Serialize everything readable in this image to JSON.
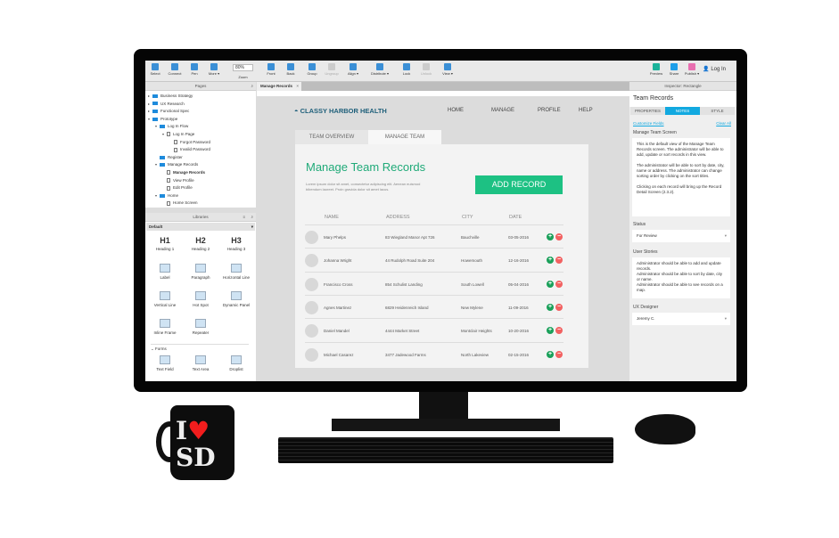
{
  "toolbar": {
    "items": [
      "Select",
      "Connect",
      "Pen",
      "More ▾",
      "Front",
      "Back",
      "Group",
      "Ungroup",
      "Align ▾",
      "Distribute ▾",
      "Lock",
      "Unlock",
      "View ▾",
      "Preview",
      "Share",
      "Publish ▾"
    ],
    "zoom": "80%",
    "zoom_label": "Zoom",
    "login": "Log In"
  },
  "pages": {
    "title": "Pages",
    "tree": [
      {
        "label": "Business Strategy",
        "level": 0,
        "type": "folder",
        "arrow": "▸"
      },
      {
        "label": "UX Research",
        "level": 0,
        "type": "folder",
        "arrow": "▸"
      },
      {
        "label": "Functional Spec",
        "level": 0,
        "type": "folder",
        "arrow": "▸"
      },
      {
        "label": "Prototype",
        "level": 0,
        "type": "folder",
        "arrow": "▾"
      },
      {
        "label": "Log In Flow",
        "level": 1,
        "type": "folder",
        "arrow": "▾"
      },
      {
        "label": "Log In Page",
        "level": 2,
        "type": "page",
        "arrow": "▾"
      },
      {
        "label": "Forgot Password",
        "level": 3,
        "type": "page",
        "arrow": ""
      },
      {
        "label": "Invalid Password",
        "level": 3,
        "type": "page",
        "arrow": ""
      },
      {
        "label": "Register",
        "level": 1,
        "type": "folder",
        "arrow": ""
      },
      {
        "label": "Manage Records",
        "level": 1,
        "type": "folder",
        "arrow": "▾"
      },
      {
        "label": "Manage Records",
        "level": 2,
        "type": "page",
        "arrow": "",
        "selected": true
      },
      {
        "label": "View Profile",
        "level": 2,
        "type": "page",
        "arrow": ""
      },
      {
        "label": "Edit Profile",
        "level": 2,
        "type": "page",
        "arrow": ""
      },
      {
        "label": "Home",
        "level": 1,
        "type": "folder",
        "arrow": "▾"
      },
      {
        "label": "Home Screen",
        "level": 2,
        "type": "page",
        "arrow": ""
      }
    ]
  },
  "libraries": {
    "title": "Libraries",
    "selected": "Default",
    "items": [
      {
        "glyph": "H1",
        "label": "Heading 1"
      },
      {
        "glyph": "H2",
        "label": "Heading 2"
      },
      {
        "glyph": "H3",
        "label": "Heading 3"
      },
      {
        "glyph": "",
        "label": "Label"
      },
      {
        "glyph": "",
        "label": "Paragraph"
      },
      {
        "glyph": "",
        "label": "Horizontal Line"
      },
      {
        "glyph": "",
        "label": "Vertical Line"
      },
      {
        "glyph": "",
        "label": "Hot Spot"
      },
      {
        "glyph": "",
        "label": "Dynamic Panel"
      },
      {
        "glyph": "",
        "label": "Inline Frame"
      },
      {
        "glyph": "",
        "label": "Repeater"
      }
    ],
    "forms_title": "Forms",
    "forms": [
      {
        "label": "Text Field"
      },
      {
        "label": "Text Area"
      },
      {
        "label": "Droplist"
      }
    ]
  },
  "canvas": {
    "tab": "Manage Records",
    "brand": "CLASSY HARBOR HEALTH",
    "nav": [
      "HOME",
      "MANAGE",
      "PROFILE",
      "HELP"
    ],
    "tabs": [
      "TEAM OVERVIEW",
      "MANAGE TEAM"
    ],
    "title": "Manage Team Records",
    "lorem": "Lorem ipsum dolor sit amet, consectetur adipiscing elit. Aenean euismod bibendum laoreet. Proin gravida dolor sit amet lacus.",
    "add_button": "ADD RECORD",
    "columns": [
      "NAME",
      "ADDRESS",
      "CITY",
      "DATE"
    ],
    "rows": [
      {
        "name": "Mary Phelps",
        "address": "83 Wiegland Manor Apt 726",
        "city": "Bauchville",
        "date": "03-05-2016"
      },
      {
        "name": "Johanna Wright",
        "address": "44 Rudolph Road Suite 204",
        "city": "Howemouth",
        "date": "12-16-2016"
      },
      {
        "name": "Francisco Cross",
        "address": "854 Schulist Landing",
        "city": "South Lowell",
        "date": "05-04-2016"
      },
      {
        "name": "Agnes Martinez",
        "address": "6829 Heidenreich Island",
        "city": "New Mylene",
        "date": "11-09-2016"
      },
      {
        "name": "Daniel Mandel",
        "address": "4444 Market Street",
        "city": "Montclair Heights",
        "date": "10-20-2016"
      },
      {
        "name": "Michael Casarez",
        "address": "3477 Jadewood Farms",
        "city": "North Lakeview",
        "date": "02-15-2016"
      }
    ]
  },
  "inspector": {
    "header": "Inspector: Rectangle",
    "title": "Team Records",
    "tabs": [
      "PROPERTIES",
      "NOTES",
      "STYLE"
    ],
    "active_tab": "NOTES",
    "customize": "Customize Fields",
    "clear": "Clear All",
    "section": "Manage Team Screen",
    "notes": [
      "This is the default view of the Manage Team Records screen. The administrator will be able to add, update or sort records in this view.",
      "The administrator will be able to sort by date, city, name or address. The administrator can change sorting order by clicking on the sort titles.",
      "Clicking on each record will bring up the Record Detail Screen (2.3.2)."
    ],
    "status_label": "Status",
    "status": "For Review",
    "stories_label": "User Stories",
    "stories": [
      "Administrator should be able to add and update records.",
      "Administrator should be able to sort by date, city or name.",
      "Administrator should be able to see records on a map."
    ],
    "designer_label": "UX Designer",
    "designer": "Jeremy C."
  },
  "mug": {
    "text": "I ♥ SD"
  },
  "colors": {
    "accent_green": "#1dc183",
    "title_green": "#1faa78",
    "notes_tab": "#12a9e0",
    "brand_blue": "#1e5f7a",
    "minus_red": "#f26161"
  }
}
